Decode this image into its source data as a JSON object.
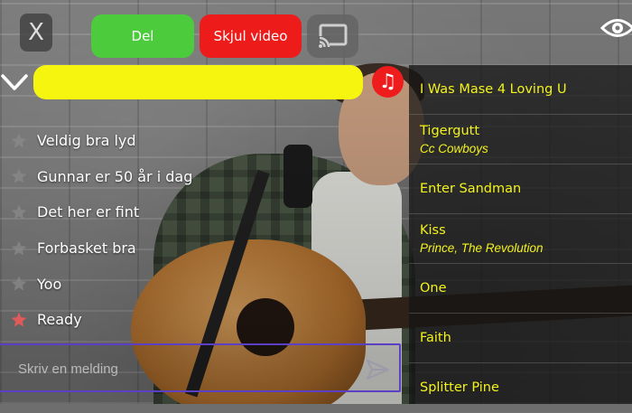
{
  "colors": {
    "share_button": "#4ccc3d",
    "hide_video_button": "#ee1b1b",
    "progress_bar": "#f5f50f",
    "music_button": "#ee1c1c",
    "song_text": "#f3f31c",
    "input_border": "#5b3fc4",
    "star_active": "#e05a5a",
    "star_inactive": "#8a8a8a"
  },
  "header": {
    "close_label": "X",
    "share_label": "Del",
    "hide_video_label": "Skjul video",
    "cast_icon": "cast-icon",
    "visibility_icon": "eye-icon"
  },
  "player": {
    "collapse_icon": "chevron-down-icon",
    "music_icon": "music-note-icon",
    "music_glyph": "♫"
  },
  "comments": [
    {
      "text": "Veldig bra lyd",
      "starred": false
    },
    {
      "text": "Gunnar er 50 år i dag",
      "starred": false
    },
    {
      "text": "Det her er fint",
      "starred": false
    },
    {
      "text": "Forbasket bra",
      "starred": false
    },
    {
      "text": "Yoo",
      "starred": false
    },
    {
      "text": "Ready",
      "starred": true
    }
  ],
  "message": {
    "placeholder": "Skriv en melding",
    "value": "",
    "send_icon": "send-icon"
  },
  "songs": [
    {
      "title": "I Was Mase 4 Loving U",
      "artist": ""
    },
    {
      "title": "Tigergutt",
      "artist": "Cc Cowboys"
    },
    {
      "title": "Enter Sandman",
      "artist": ""
    },
    {
      "title": "Kiss",
      "artist": "Prince, The Revolution"
    },
    {
      "title": "One",
      "artist": ""
    },
    {
      "title": "Faith",
      "artist": ""
    },
    {
      "title": "Splitter Pine",
      "artist": ""
    }
  ]
}
